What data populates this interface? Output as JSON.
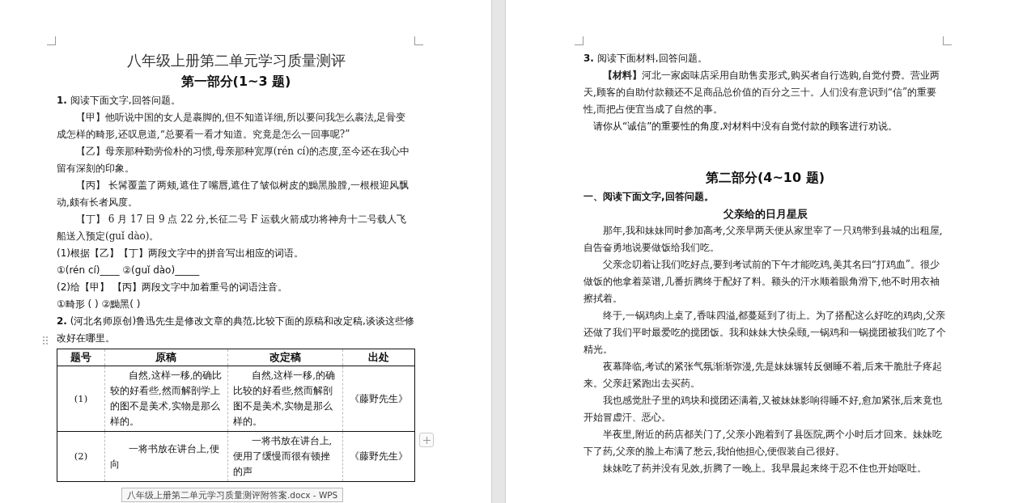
{
  "left_page": {
    "title": "八年级上册第二单元学习质量测评",
    "part_heading": "第一部分(1~3 题)",
    "blocks": [
      {
        "kind": "question",
        "text": "**1.** 阅读下面文字,回答问题。"
      },
      {
        "kind": "passage",
        "text": "【甲】他听说中国的女人是裹脚的,但不知道详细,所以要问我怎么裹法,足骨变成怎样的畸形,还叹息道,“总要看一看才知道。究竟是怎么一回事呢?”"
      },
      {
        "kind": "passage",
        "text": "【乙】母亲那种勤劳俭朴的习惯,母亲那种宽厚(rén cí)的态度,至今还在我心中留有深刻的印象。"
      },
      {
        "kind": "passage",
        "text": "【丙】 长髯覆盖了两颊,遮住了嘴唇,遮住了皱似树皮的黝黑脸膛,一根根迎风飘动,颇有长者风度。"
      },
      {
        "kind": "passage",
        "text": "【丁】 6 月 17 日 9 点 22 分,长征二号 F 运载火箭成功将神舟十二号载人飞船送入预定(guǐ dào)。"
      },
      {
        "kind": "question",
        "text": "(1)根据【乙】【丁】两段文字中的拼音写出相应的词语。"
      },
      {
        "kind": "question",
        "text": "①(rén cí)____ ②(guǐ dào)_____"
      },
      {
        "kind": "question",
        "text": "(2)给【甲】 【丙】两段文字中加着重号的词语注音。"
      },
      {
        "kind": "question",
        "text": "①畸形 (      ) ②黝黑(      )"
      },
      {
        "kind": "question",
        "text": "**2.** (河北名师原创)鲁迅先生是修改文章的典范,比较下面的原稿和改定稿,谈谈这些修改好在哪里。"
      }
    ],
    "table": {
      "columns": [
        "题号",
        "原稿",
        "改定稿",
        "出处"
      ],
      "rows": [
        [
          "(1)",
          "自然,这样一移,的确比较的好看些,然而解剖学上的图不是美术,实物是那么样的。",
          "自然,这样一移,的确比较的好看些,然而解剖图不是美术,实物是那么样的。",
          "《藤野先生》"
        ],
        [
          "(2)",
          "一将书放在讲台上,便向",
          "一将书放在讲台上,便用了缓慢而很有顿挫的声",
          "《藤野先生》"
        ]
      ]
    }
  },
  "right_page": {
    "blocks_top": [
      {
        "kind": "question",
        "text": "**3.** 阅读下面材料,回答问题。"
      },
      {
        "kind": "passage",
        "text": "**【材料】**河北一家卤味店采用自助售卖形式,购买者自行选购,自觉付费。营业两天,顾客的自助付款额还不足商品总价值的百分之三十。人们没有意识到“信”的重要性,而把占便宜当成了自然的事。"
      },
      {
        "kind": "prompt",
        "text": "请你从“诚信”的重要性的角度,对材料中没有自觉付款的顾客进行劝说。"
      }
    ],
    "part_heading": "第二部分(4~10 题)",
    "blocks": [
      {
        "kind": "section",
        "text": "一、阅读下面文字,回答问题。"
      },
      {
        "kind": "story_title",
        "text": "父亲给的日月星辰"
      },
      {
        "kind": "passage",
        "text": "那年,我和妹妹同时参加高考,父亲早两天便从家里宰了一只鸡带到县城的出租屋,自告奋勇地说要做饭给我们吃。"
      },
      {
        "kind": "passage",
        "text": "父亲念叨着让我们吃好点,要到考试前的下午才能吃鸡,美其名曰“打鸡血”。很少做饭的他拿着菜谱,几番折腾终于配好了料。额头的汗水顺着眼角滑下,他不时用衣袖擦拭着。"
      },
      {
        "kind": "passage",
        "text": "终于,一锅鸡肉上桌了,香味四溢,都蔓延到了街上。为了搭配这么好吃的鸡肉,父亲还做了我们平时最爱吃的搅团饭。我和妹妹大快朵颐,一锅鸡和一锅搅团被我们吃了个精光。"
      },
      {
        "kind": "passage",
        "text": "夜幕降临,考试的紧张气氛渐渐弥漫,先是妹妹辗转反侧睡不着,后来干脆肚子疼起来。父亲赶紧跑出去买药。"
      },
      {
        "kind": "passage",
        "text": "我也感觉肚子里的鸡块和搅团还满着,又被妹妹影响得睡不好,愈加紧张,后来竟也开始冒虚汗、恶心。"
      },
      {
        "kind": "passage",
        "text": "半夜里,附近的药店都关门了,父亲小跑着到了县医院,两个小时后才回来。妹妹吃下了药,父亲的脸上布满了愁云,我怕他担心,便假装自己很好。"
      },
      {
        "kind": "passage",
        "text": "妹妹吃了药并没有见效,折腾了一晚上。我早晨起来终于忍不住也开始呕吐。"
      }
    ]
  },
  "taskbar_tooltip": "八年级上册第二单元学习质量测评附答案.docx - WPS"
}
